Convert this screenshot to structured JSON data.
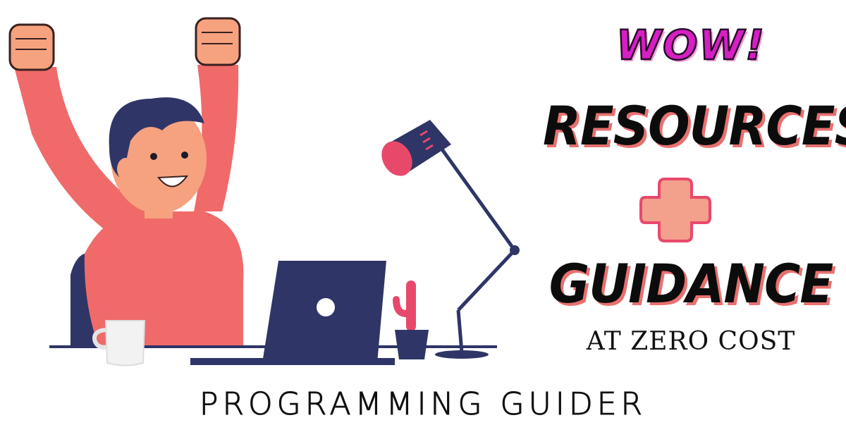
{
  "headline": {
    "exclaim": "WOW!",
    "line1": "RESOURCES",
    "line2": "GUIDANCE",
    "tagline": "AT ZERO COST"
  },
  "brand": "PROGRAMMING GUIDER",
  "icons": {
    "plus": "plus-icon",
    "illustration": "celebrating-developer-illustration"
  },
  "colors": {
    "accent_pink": "#d61fc4",
    "shadow_red": "#e87070",
    "plus_fill": "#f3a08c",
    "plus_stroke": "#e8496b",
    "shirt": "#f06a6a",
    "navy": "#2f3566"
  }
}
